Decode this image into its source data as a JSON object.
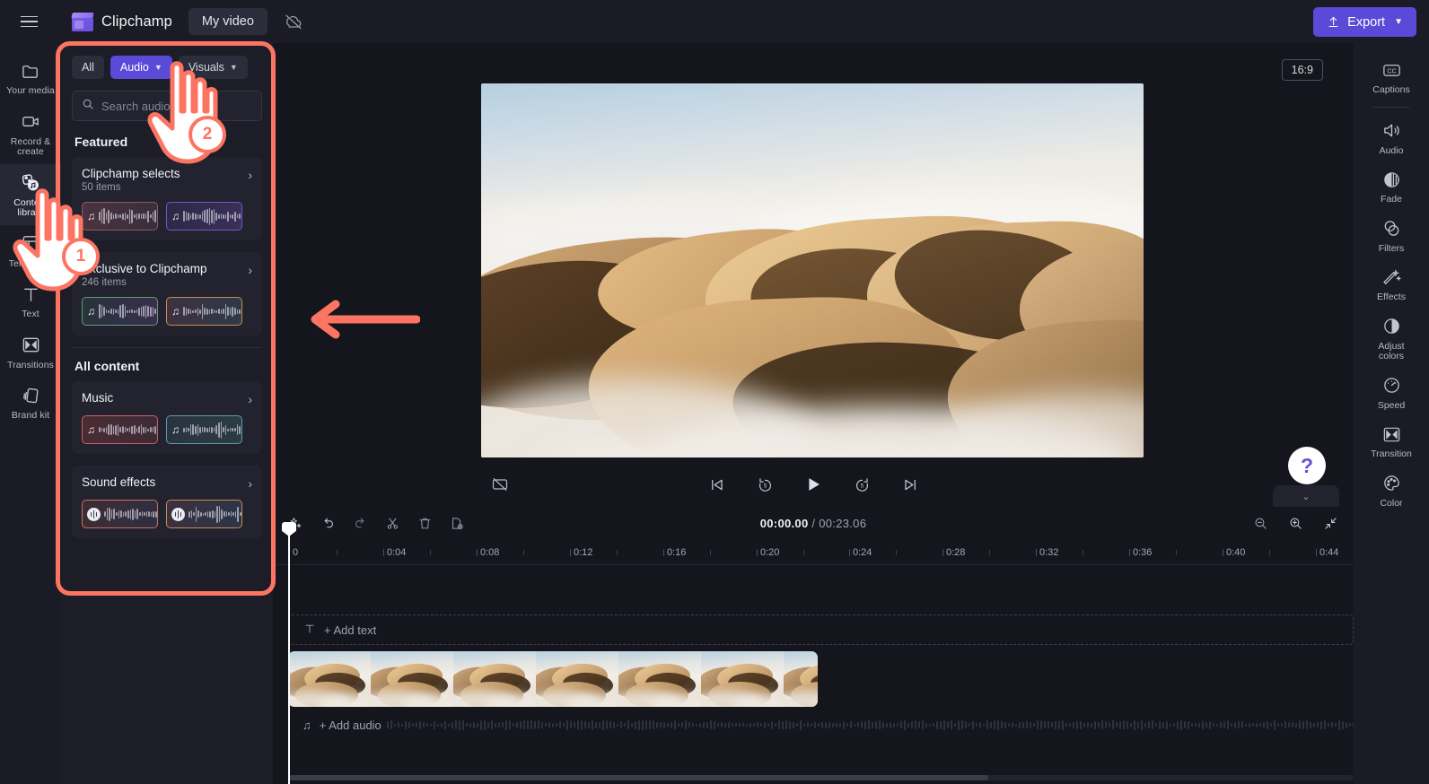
{
  "app": {
    "brand_name": "Clipchamp",
    "project_tab": "My video",
    "menu_icon": "hamburger-icon",
    "cloud_icon": "cloud-off-icon",
    "export_label": "Export"
  },
  "left_rail": {
    "items": [
      {
        "label": "Your media",
        "icon": "folder-icon",
        "active": false
      },
      {
        "label": "Record &\ncreate",
        "icon": "camera-icon",
        "active": false
      },
      {
        "label": "Content\nlibrary",
        "icon": "content-library-icon",
        "active": true
      },
      {
        "label": "Templates",
        "icon": "templates-icon",
        "active": false
      },
      {
        "label": "Text",
        "icon": "text-icon",
        "active": false
      },
      {
        "label": "Transitions",
        "icon": "transitions-icon",
        "active": false
      },
      {
        "label": "Brand kit",
        "icon": "brand-kit-icon",
        "active": false
      }
    ]
  },
  "panel": {
    "filters": [
      {
        "label": "All",
        "active": false,
        "chevron": false
      },
      {
        "label": "Audio",
        "active": true,
        "chevron": true
      },
      {
        "label": "Visuals",
        "active": false,
        "chevron": true
      }
    ],
    "search_placeholder": "Search audio",
    "search_value": "",
    "featured_title": "Featured",
    "featured_cards": [
      {
        "title": "Clipchamp selects",
        "subtitle": "50 items"
      },
      {
        "title": "Exclusive to Clipchamp",
        "subtitle": "246 items"
      }
    ],
    "all_content_title": "All content",
    "all_content_cards": [
      {
        "title": "Music",
        "subtitle": ""
      },
      {
        "title": "Sound effects",
        "subtitle": ""
      }
    ]
  },
  "preview": {
    "aspect_ratio": "16:9",
    "controls": [
      {
        "name": "captions-off-icon"
      },
      {
        "name": "skip-to-start-icon"
      },
      {
        "name": "rewind-5s-icon"
      },
      {
        "name": "play-icon"
      },
      {
        "name": "forward-5s-icon"
      },
      {
        "name": "skip-to-end-icon"
      },
      {
        "name": "fullscreen-icon"
      }
    ],
    "help_label": "?"
  },
  "right_rail": {
    "items": [
      {
        "label": "Captions",
        "icon": "captions-icon"
      },
      {
        "label": "Audio",
        "icon": "speaker-icon"
      },
      {
        "label": "Fade",
        "icon": "fade-icon"
      },
      {
        "label": "Filters",
        "icon": "filters-icon"
      },
      {
        "label": "Effects",
        "icon": "effects-icon"
      },
      {
        "label": "Adjust\ncolors",
        "icon": "adjust-colors-icon"
      },
      {
        "label": "Speed",
        "icon": "speed-icon"
      },
      {
        "label": "Transition",
        "icon": "transition-icon"
      },
      {
        "label": "Color",
        "icon": "color-palette-icon"
      }
    ]
  },
  "timeline": {
    "tools": [
      {
        "name": "magic-sparkle-icon"
      },
      {
        "name": "undo-icon"
      },
      {
        "name": "redo-icon"
      },
      {
        "name": "split-scissors-icon"
      },
      {
        "name": "delete-trash-icon"
      },
      {
        "name": "duplicate-icon"
      }
    ],
    "current_time": "00:00.00",
    "total_time": "/ 00:23.06",
    "zoom_tools": [
      {
        "name": "zoom-out-icon"
      },
      {
        "name": "zoom-in-icon"
      },
      {
        "name": "fit-to-screen-icon"
      }
    ],
    "ruler_labels": [
      "0",
      "0:04",
      "0:08",
      "0:12",
      "0:16",
      "0:20",
      "0:24",
      "0:28",
      "0:32",
      "0:36",
      "0:40",
      "0:44"
    ],
    "add_text_label": "+ Add text",
    "add_audio_label": "+ Add audio"
  },
  "annotations": {
    "step_1": "1",
    "step_2": "2",
    "highlight_color": "#fd7562"
  }
}
